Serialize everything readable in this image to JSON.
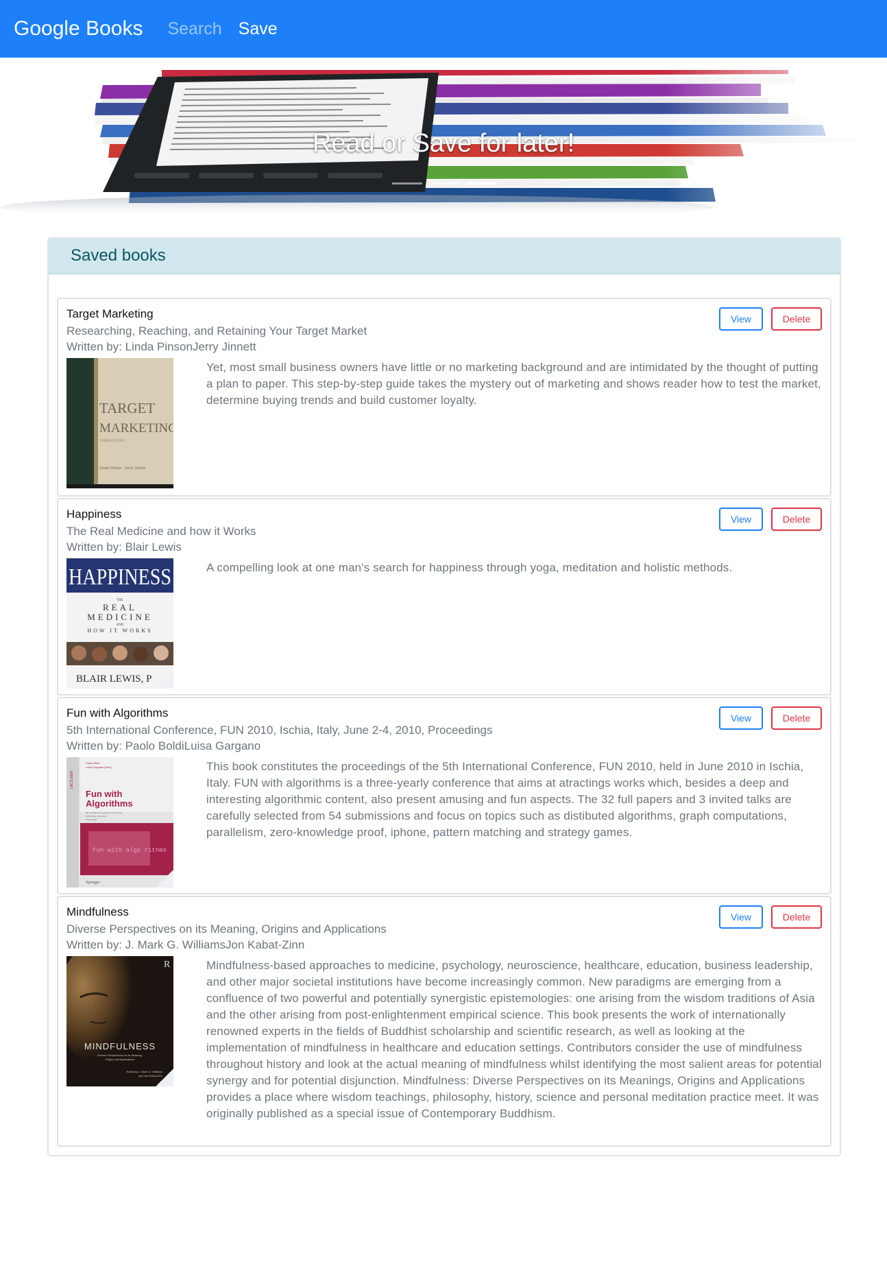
{
  "navbar": {
    "brand": "Google Books",
    "links": [
      {
        "label": "Search"
      },
      {
        "label": "Save"
      }
    ]
  },
  "hero": {
    "caption": "Read or Save for later!",
    "indicator_count": 3,
    "active_indicator": 3
  },
  "saved": {
    "title": "Saved books",
    "books": [
      {
        "title": "Target Marketing",
        "subtitle": "Researching, Reaching, and Retaining Your Target Market",
        "authors": "Written by: Linda PinsonJerry Jinnett",
        "description": "Yet, most small business owners have little or no marketing background and are intimidated by the thought of putting a plan to paper. This step-by-step guide takes the mystery out of marketing and shows reader how to test the market, determine buying trends and build customer loyalty.",
        "view_label": "View",
        "delete_label": "Delete"
      },
      {
        "title": "Happiness",
        "subtitle": "The Real Medicine and how it Works",
        "authors": "Written by: Blair Lewis",
        "description": "A compelling look at one man's search for happiness through yoga, meditation and holistic methods.",
        "view_label": "View",
        "delete_label": "Delete"
      },
      {
        "title": "Fun with Algorithms",
        "subtitle": "5th International Conference, FUN 2010, Ischia, Italy, June 2-4, 2010, Proceedings",
        "authors": "Written by: Paolo BoldiLuisa Gargano",
        "description": "This book constitutes the proceedings of the 5th International Conference, FUN 2010, held in June 2010 in Ischia, Italy. FUN with algorithms is a three-yearly conference that aims at atractings works which, besides a deep and interesting algorithmic content, also present amusing and fun aspects. The 32 full papers and 3 invited talks are carefully selected from 54 submissions and focus on topics such as distibuted algorithms, graph computations, parallelism, zero-knowledge proof, iphone, pattern matching and strategy games.",
        "view_label": "View",
        "delete_label": "Delete"
      },
      {
        "title": "Mindfulness",
        "subtitle": "Diverse Perspectives on its Meaning, Origins and Applications",
        "authors": "Written by: J. Mark G. WilliamsJon Kabat-Zinn",
        "description": "Mindfulness-based approaches to medicine, psychology, neuroscience, healthcare, education, business leadership, and other major societal institutions have become increasingly common. New paradigms are emerging from a confluence of two powerful and potentially synergistic epistemologies: one arising from the wisdom traditions of Asia and the other arising from post-enlightenment empirical science. This book presents the work of internationally renowned experts in the fields of Buddhist scholarship and scientific research, as well as looking at the implementation of mindfulness in healthcare and education settings. Contributors consider the use of mindfulness throughout history and look at the actual meaning of mindfulness whilst identifying the most salient areas for potential synergy and for potential disjunction. Mindfulness: Diverse Perspectives on its Meanings, Origins and Applications provides a place where wisdom teachings, philosophy, history, science and personal meditation practice meet. It was originally published as a special issue of Contemporary Buddhism.",
        "view_label": "View",
        "delete_label": "Delete"
      }
    ]
  },
  "covers": {
    "target": {
      "lines": [
        "TARGET",
        "MARKETING",
        "THIRD EDITION",
        "Linda Pinson · Jerry Jinnett"
      ],
      "colors": {
        "spine": "#22382c",
        "page": "#d8ceb5"
      }
    },
    "happiness": {
      "lines": [
        "HAPPINESS",
        "THE",
        "REAL",
        "MEDICINE",
        "AND",
        "HOW IT WORKS",
        "BLAIR LEWIS, P"
      ],
      "colors": {
        "band": "#253572"
      }
    },
    "algorithms": {
      "lines": [
        "Paolo Boldi",
        "Luisa Gargano (Eds.)",
        "LNCS 6099",
        "Fun with",
        "Algorithms",
        "5th International Conference, FUN 2010",
        "Ischia, Italy, June 2010",
        "Proceedings",
        "Fun with algo rithms",
        "Springer"
      ],
      "colors": {
        "maroon": "#a3224a"
      }
    },
    "mindfulness": {
      "lines": [
        "R",
        "MINDFULNESS",
        "Diverse Perspectives on its Meaning,",
        "Origins and Applications",
        "Edited by J. Mark G. Williams",
        "and Jon Kabat-Zinn"
      ],
      "colors": {
        "bg": "#1b1410"
      }
    }
  }
}
